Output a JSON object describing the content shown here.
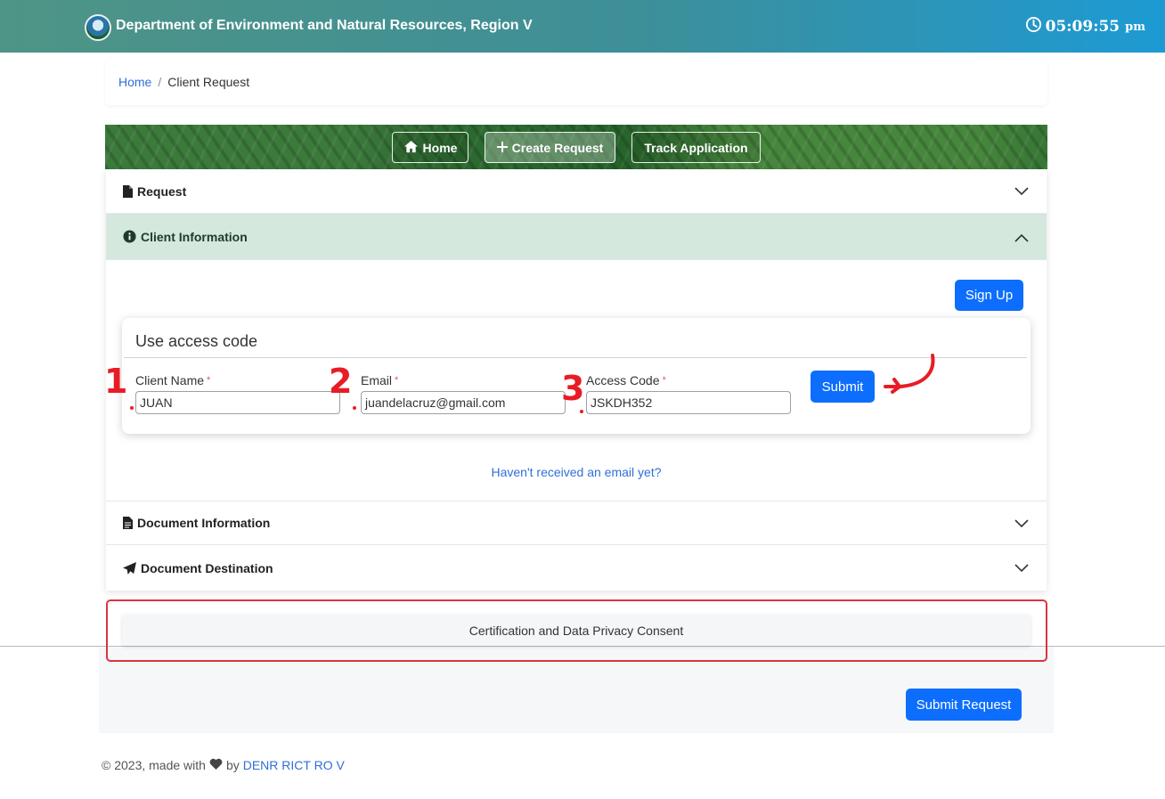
{
  "header": {
    "org_name": "Department of Environment and Natural Resources, Region V",
    "clock_time": "05:09:55",
    "clock_ampm": "pm"
  },
  "breadcrumb": {
    "home": "Home",
    "separator": "/",
    "current": "Client Request"
  },
  "nav": {
    "home_label": "Home",
    "create_label": "Create Request",
    "track_label": "Track Application"
  },
  "sections": {
    "request": "Request",
    "client_information": "Client Information",
    "document_information": "Document Information",
    "document_destination": "Document Destination"
  },
  "client_form": {
    "signup_label": "Sign Up",
    "card_title": "Use access code",
    "client_name_label": "Client Name",
    "client_name_value": "JUAN",
    "email_label": "Email",
    "email_value": "juandelacruz@gmail.com",
    "access_code_label": "Access Code",
    "access_code_value": "JSKDH352",
    "required_mark": "*",
    "submit_label": "Submit",
    "no_email_link": "Haven't received an email yet?"
  },
  "consent": {
    "label": "Certification and Data Privacy Consent"
  },
  "submit_request_label": "Submit Request",
  "footer": {
    "prefix": "© 2023, made with",
    "by": "by",
    "link": "DENR RICT RO V"
  },
  "annotations": {
    "n1": "1",
    "n2": "2",
    "n3": "3"
  },
  "colors": {
    "primary": "#0d6efd",
    "annotation_red": "#e81c24",
    "open_section_bg": "#d4e8de",
    "link": "#2f6fd7"
  },
  "icons": [
    "clock-icon",
    "home-icon",
    "plus-icon",
    "file-icon",
    "info-circle-icon",
    "chevron-down-icon",
    "chevron-up-icon",
    "paper-plane-icon",
    "heart-icon"
  ]
}
